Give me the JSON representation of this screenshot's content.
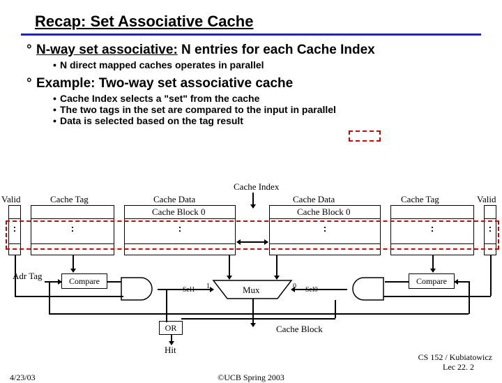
{
  "title": "Recap: Set Associative Cache",
  "bullet1": {
    "lead": "N-way set associative:",
    "rest": " N entries for each Cache Index",
    "sub1": "N direct mapped caches operates in parallel"
  },
  "bullet2": {
    "text": "Example: Two-way set associative cache",
    "sub1": "Cache Index selects a \"set\" from the cache",
    "sub2": "The two tags in the set are compared to the input in parallel",
    "sub3": "Data is selected based on the tag result"
  },
  "diagram": {
    "cache_index": "Cache Index",
    "valid_l": "Valid",
    "valid_r": "Valid",
    "tag_l": "Cache Tag",
    "tag_r": "Cache Tag",
    "data_l": "Cache Data",
    "data_r": "Cache Data",
    "block0_l": "Cache Block 0",
    "block0_r": "Cache Block 0",
    "adr_tag": "Adr Tag",
    "compare_l": "Compare",
    "compare_r": "Compare",
    "sel1": "Sel1",
    "sel0": "Sel0",
    "one": "1",
    "zero": "0",
    "mux": "Mux",
    "or": "OR",
    "hit": "Hit",
    "cache_block": "Cache Block"
  },
  "footer": {
    "date": "4/23/03",
    "copyright": "©UCB Spring 2003",
    "course1": "CS 152 / Kubiatowicz",
    "course2": "Lec 22. 2"
  }
}
